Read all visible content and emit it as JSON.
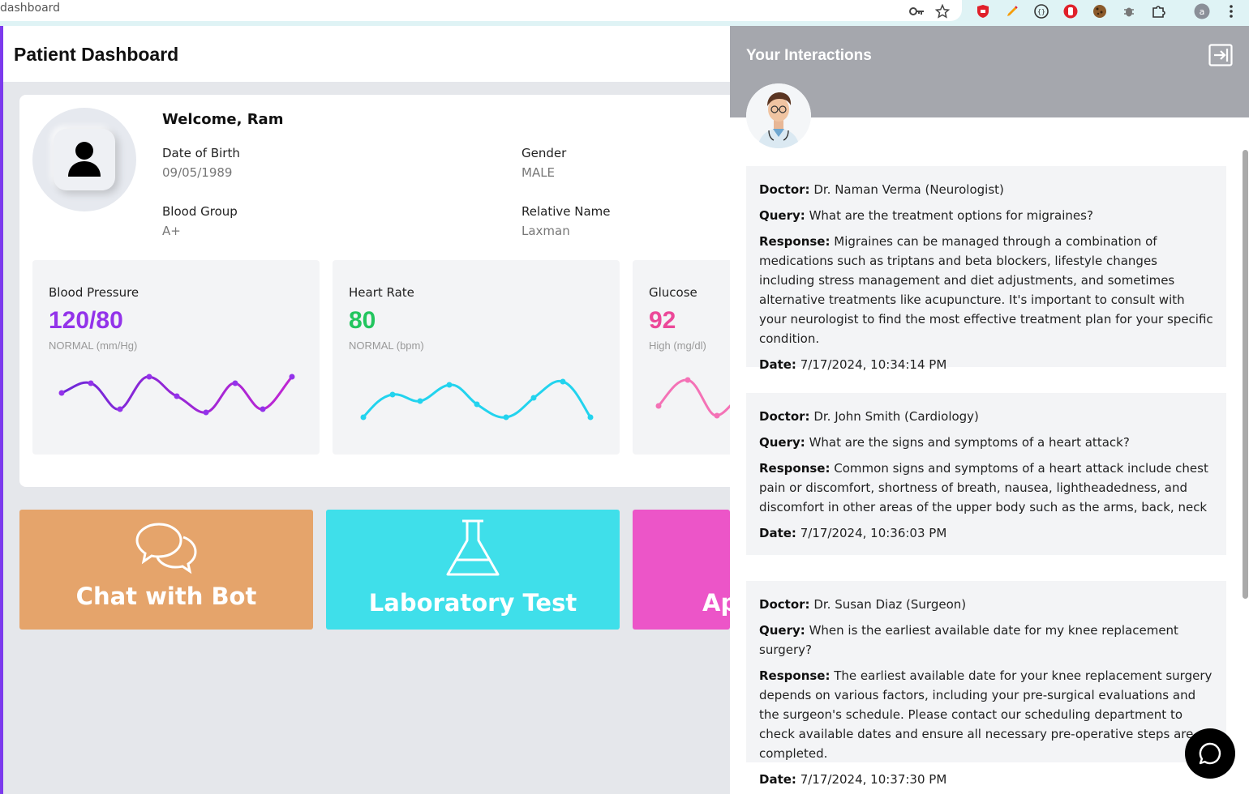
{
  "browser": {
    "url": "dashboard"
  },
  "header": {
    "title": "Patient Dashboard"
  },
  "profile": {
    "welcome": "Welcome, Ram",
    "dob_label": "Date of Birth",
    "dob": "09/05/1989",
    "gender_label": "Gender",
    "gender": "MALE",
    "blood_group_label": "Blood Group",
    "blood_group": "A+",
    "relative_label": "Relative Name",
    "relative": "Laxman"
  },
  "vitals": [
    {
      "label": "Blood Pressure",
      "value": "120/80",
      "status": "NORMAL (mm/Hg)",
      "color": "#9333ea"
    },
    {
      "label": "Heart Rate",
      "value": "80",
      "status": "NORMAL (bpm)",
      "color": "#22c55e"
    },
    {
      "label": "Glucose",
      "value": "92",
      "status": "High (mg/dl)",
      "color": "#ec4899"
    }
  ],
  "tiles": [
    {
      "label": "Chat with Bot",
      "icon": "chat-bubbles-icon",
      "color": "#e5a46b"
    },
    {
      "label": "Laboratory Test",
      "icon": "flask-icon",
      "color": "#3fdfea"
    },
    {
      "label": "Ap",
      "color": "#ec55c8"
    }
  ],
  "panel": {
    "title": "Your Interactions",
    "labels": {
      "doctor": "Doctor:",
      "query": "Query:",
      "response": "Response:",
      "date": "Date:"
    },
    "interactions": [
      {
        "doctor": "Dr. Naman Verma (Neurologist)",
        "query": "What are the treatment options for migraines?",
        "response": "Migraines can be managed through a combination of medications such as triptans and beta blockers, lifestyle changes including stress management and diet adjustments, and sometimes alternative treatments like acupuncture. It's important to consult with your neurologist to find the most effective treatment plan for your specific condition.",
        "date": "7/17/2024, 10:34:14 PM"
      },
      {
        "doctor": "Dr. John Smith (Cardiology)",
        "query": "What are the signs and symptoms of a heart attack?",
        "response": "Common signs and symptoms of a heart attack include chest pain or discomfort, shortness of breath, nausea, lightheadedness, and discomfort in other areas of the upper body such as the arms, back, neck",
        "date": "7/17/2024, 10:36:03 PM"
      },
      {
        "doctor": "Dr. Susan Diaz (Surgeon)",
        "query": "When is the earliest available date for my knee replacement surgery?",
        "response": "The earliest available date for your knee replacement surgery depends on various factors, including your pre-surgical evaluations and the surgeon's schedule. Please contact our scheduling department to check available dates and ensure all necessary pre-operative steps are completed.",
        "date": "7/17/2024, 10:37:30 PM"
      }
    ]
  }
}
